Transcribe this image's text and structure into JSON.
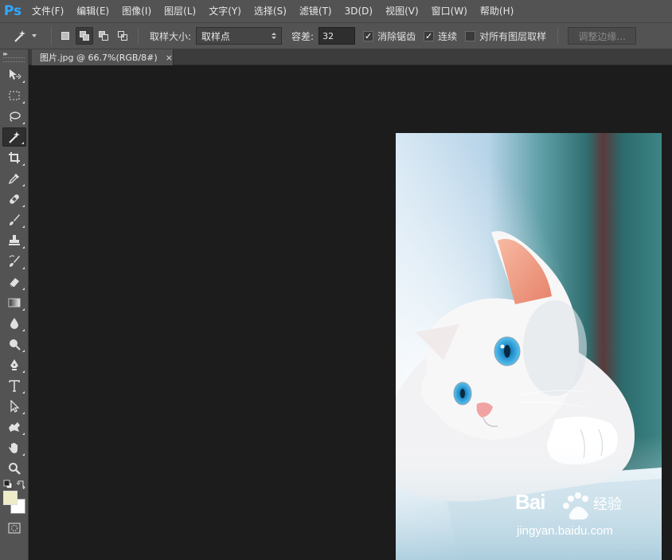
{
  "app": {
    "logo": "Ps"
  },
  "menu": {
    "items": [
      "文件(F)",
      "编辑(E)",
      "图像(I)",
      "图层(L)",
      "文字(Y)",
      "选择(S)",
      "滤镜(T)",
      "3D(D)",
      "视图(V)",
      "窗口(W)",
      "帮助(H)"
    ]
  },
  "options": {
    "sample_size_label": "取样大小:",
    "sample_size_value": "取样点",
    "tolerance_label": "容差:",
    "tolerance_value": "32",
    "antialias_label": "消除锯齿",
    "antialias_checked": true,
    "contiguous_label": "连续",
    "contiguous_checked": true,
    "all_layers_label": "对所有图层取样",
    "all_layers_checked": false,
    "refine_edge_label": "调整边缘..."
  },
  "document": {
    "tab_title": "图片.jpg @ 66.7%(RGB/8#)",
    "close_glyph": "×"
  },
  "colors": {
    "foreground": "#eeecc8",
    "background": "#ffffff",
    "accent": "#31a8ff"
  },
  "watermark": {
    "brand": "Bai",
    "brand_cn": "经验",
    "url": "jingyan.baidu.com"
  }
}
